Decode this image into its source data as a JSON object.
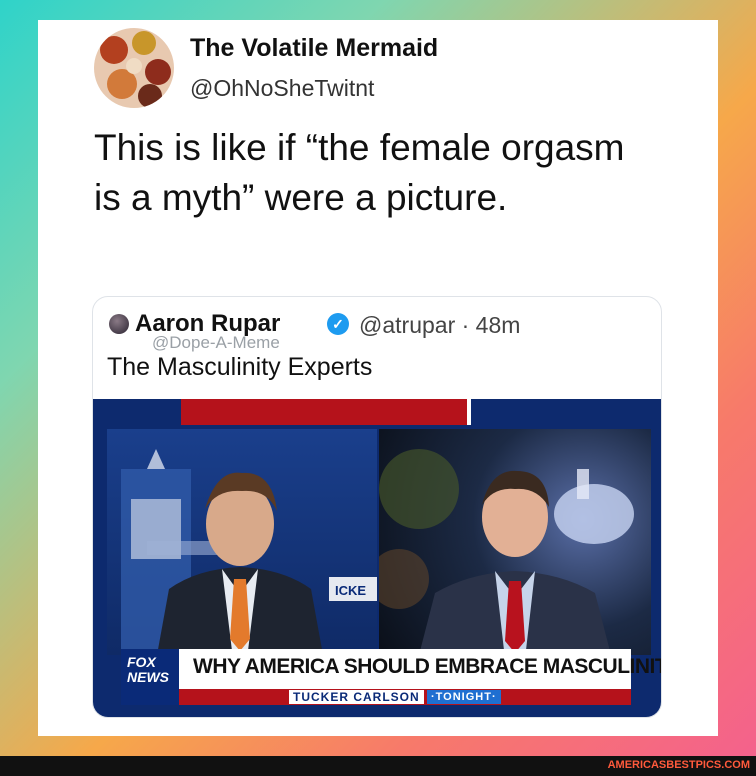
{
  "tweet": {
    "display_name": "The Volatile Mermaid",
    "handle": "@OhNoSheTwitnt",
    "text": "This is like if “the female orgasm is a myth” were a picture."
  },
  "quoted_tweet": {
    "name": "Aaron Rupar",
    "handle_time": "@atrupar · 48m",
    "text": "The Masculinity Experts",
    "watermark": "@Dope-A-Meme",
    "video": {
      "headline": "WHY AMERICA SHOULD EMBRACE MASCULINITY",
      "show": "TUCKER CARLSON",
      "tonight": "·TONIGHT·",
      "logo_line1": "FOX",
      "logo_line2": "NEWS",
      "screen_fragment": "ICKE"
    }
  },
  "footer": {
    "url": "AMERICASBESTPICS.COM"
  },
  "colors": {
    "fox_red": "#b5121b",
    "fox_blue": "#0a2a78",
    "verified": "#1d9bf0",
    "footer_url": "#ff5a3c"
  }
}
